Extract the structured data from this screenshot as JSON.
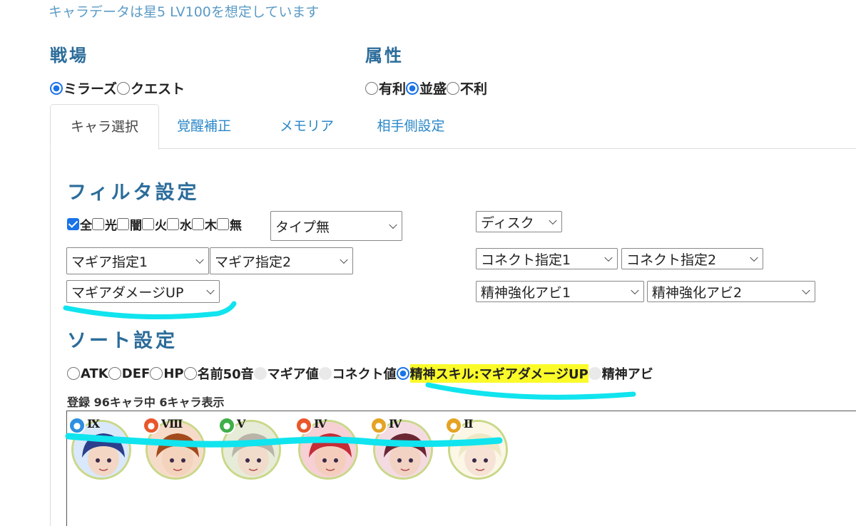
{
  "note": "キャラデータは星5 LV100を想定しています",
  "battle": {
    "heading": "戦場",
    "options": [
      {
        "label": "ミラーズ",
        "selected": true
      },
      {
        "label": "クエスト",
        "selected": false
      }
    ]
  },
  "attribute": {
    "heading": "属性",
    "options": [
      {
        "label": "有利",
        "selected": false
      },
      {
        "label": "並盛",
        "selected": true
      },
      {
        "label": "不利",
        "selected": false
      }
    ]
  },
  "tabs": [
    {
      "label": "キャラ選択",
      "active": true
    },
    {
      "label": "覚醒補正",
      "active": false
    },
    {
      "label": "メモリア",
      "active": false
    },
    {
      "label": "相手側設定",
      "active": false
    }
  ],
  "filter": {
    "heading": "フィルタ設定",
    "elements": [
      {
        "label": "全",
        "checked": true
      },
      {
        "label": "光",
        "checked": false
      },
      {
        "label": "闇",
        "checked": false
      },
      {
        "label": "火",
        "checked": false
      },
      {
        "label": "水",
        "checked": false
      },
      {
        "label": "木",
        "checked": false
      },
      {
        "label": "無",
        "checked": false
      }
    ],
    "type_select": "タイプ無",
    "disc_select": "ディスク",
    "magia1": "マギア指定1",
    "magia2": "マギア指定2",
    "connect1": "コネクト指定1",
    "connect2": "コネクト指定2",
    "magia_damage": "マギアダメージUP",
    "spirit_ability1": "精神強化アビ1",
    "spirit_ability2": "精神強化アビ2"
  },
  "sort": {
    "heading": "ソート設定",
    "options": [
      {
        "label": "ATK",
        "state": "off"
      },
      {
        "label": "DEF",
        "state": "off"
      },
      {
        "label": "HP",
        "state": "off"
      },
      {
        "label": "名前50音",
        "state": "off"
      },
      {
        "label": "マギア値",
        "state": "disabled"
      },
      {
        "label": "コネクト値",
        "state": "disabled"
      },
      {
        "label": "精神スキル:マギアダメージUP",
        "state": "on",
        "highlight": true
      },
      {
        "label": "精神アビ",
        "state": "disabled"
      }
    ]
  },
  "result_count": "登録 96キャラ中 6キャラ表示",
  "characters": [
    {
      "rank": "Ⅸ",
      "element": "water",
      "badge_color": "#2f8fe0",
      "skin": "#f3d7c4",
      "hair": "#2b3f8c",
      "bg": "#d9e8fb"
    },
    {
      "rank": "Ⅷ",
      "element": "fire",
      "badge_color": "#e9572b",
      "skin": "#f4d3bd",
      "hair": "#a24a1c",
      "bg": "#f7dbc9"
    },
    {
      "rank": "Ⅴ",
      "element": "forest",
      "badge_color": "#3fae4a",
      "skin": "#f1dccb",
      "hair": "#b9b3a8",
      "bg": "#e6ecd8"
    },
    {
      "rank": "Ⅳ",
      "element": "fire",
      "badge_color": "#e9572b",
      "skin": "#f4cdbd",
      "hair": "#c42c36",
      "bg": "#f6d0d4"
    },
    {
      "rank": "Ⅳ",
      "element": "light",
      "badge_color": "#e5a323",
      "skin": "#f2d2c3",
      "hair": "#6b2634",
      "bg": "#f4dbe1"
    },
    {
      "rank": "Ⅱ",
      "element": "light",
      "badge_color": "#e5a323",
      "skin": "#f6e3d5",
      "hair": "#efe8c6",
      "bg": "#fbf6e6"
    }
  ]
}
